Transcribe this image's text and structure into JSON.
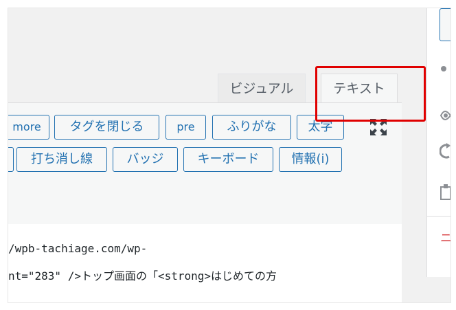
{
  "editor": {
    "tabs": {
      "visual": "ビジュアル",
      "text": "テキスト"
    },
    "quicktags_row1": [
      "more",
      "タグを閉じる",
      "pre",
      "ふりがな",
      "太字"
    ],
    "quicktags_row2": [
      "打ち消し線",
      "バッジ",
      "キーボード",
      "情報(i)"
    ],
    "fullscreen_icon": "fullscreen-icon",
    "content_lines": [
      "/wpb-tachiage.com/wp-",
      "nt=\"283\" />トップ画面の「<strong>はじめての方"
    ]
  },
  "sidebar": {
    "partial_text": "ニ",
    "icons": [
      "dot-icon",
      "eye-icon",
      "revisions-icon",
      "clipboard-icon"
    ]
  },
  "colors": {
    "button_border": "#2271b1",
    "highlight": "#e00000"
  }
}
